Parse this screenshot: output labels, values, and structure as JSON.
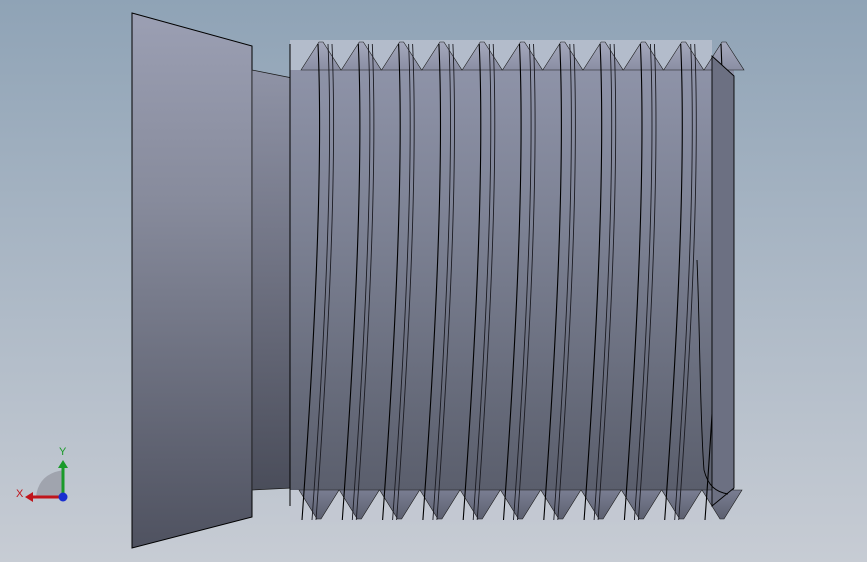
{
  "viewport": {
    "background_top": "#8fa3b6",
    "background_bottom": "#c7ccd4"
  },
  "model": {
    "part": "threaded-fitting",
    "thread_crests_visible": 11,
    "face_color": "#7d8291",
    "line_color": "#000000"
  },
  "triad": {
    "x_label": "X",
    "y_label": "Y",
    "x_color": "#c0151b",
    "y_color": "#1a9a2a",
    "z_color": "#1a2fd0"
  }
}
